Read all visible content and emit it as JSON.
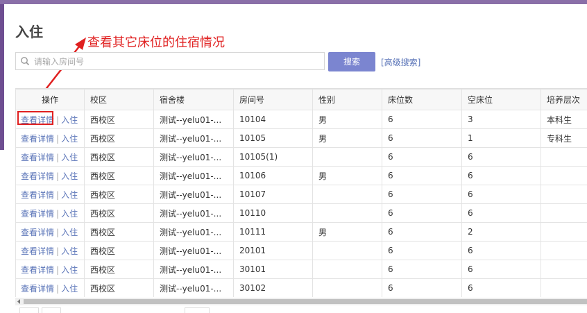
{
  "page": {
    "title": "入住"
  },
  "annotation": {
    "text": "查看其它床位的住宿情况",
    "color": "#e02020"
  },
  "search": {
    "placeholder": "请输入房间号",
    "button_label": "搜索",
    "advanced_label": "[高级搜索]"
  },
  "table": {
    "columns": [
      "操作",
      "校区",
      "宿舍楼",
      "房间号",
      "性别",
      "床位数",
      "空床位",
      "培养层次"
    ],
    "actions": {
      "detail": "查看详情",
      "separator": "|",
      "checkin": "入住"
    },
    "rows": [
      [
        "西校区",
        "测试--yelu01-...",
        "10104",
        "男",
        "6",
        "3",
        "本科生"
      ],
      [
        "西校区",
        "测试--yelu01-...",
        "10105",
        "男",
        "6",
        "1",
        "专科生"
      ],
      [
        "西校区",
        "测试--yelu01-...",
        "10105(1)",
        "",
        "6",
        "6",
        ""
      ],
      [
        "西校区",
        "测试--yelu01-...",
        "10106",
        "男",
        "6",
        "6",
        ""
      ],
      [
        "西校区",
        "测试--yelu01-...",
        "10107",
        "",
        "6",
        "6",
        ""
      ],
      [
        "西校区",
        "测试--yelu01-...",
        "10110",
        "",
        "6",
        "6",
        ""
      ],
      [
        "西校区",
        "测试--yelu01-...",
        "10111",
        "男",
        "6",
        "2",
        ""
      ],
      [
        "西校区",
        "测试--yelu01-...",
        "20101",
        "",
        "6",
        "6",
        ""
      ],
      [
        "西校区",
        "测试--yelu01-...",
        "30101",
        "",
        "6",
        "6",
        ""
      ],
      [
        "西校区",
        "测试--yelu01-...",
        "30102",
        "",
        "6",
        "6",
        ""
      ]
    ]
  },
  "colors": {
    "accent": "#7b85d0",
    "link": "#5a74b8",
    "topbar": "#8a6fa8"
  },
  "icons": {
    "search": "search-icon"
  }
}
